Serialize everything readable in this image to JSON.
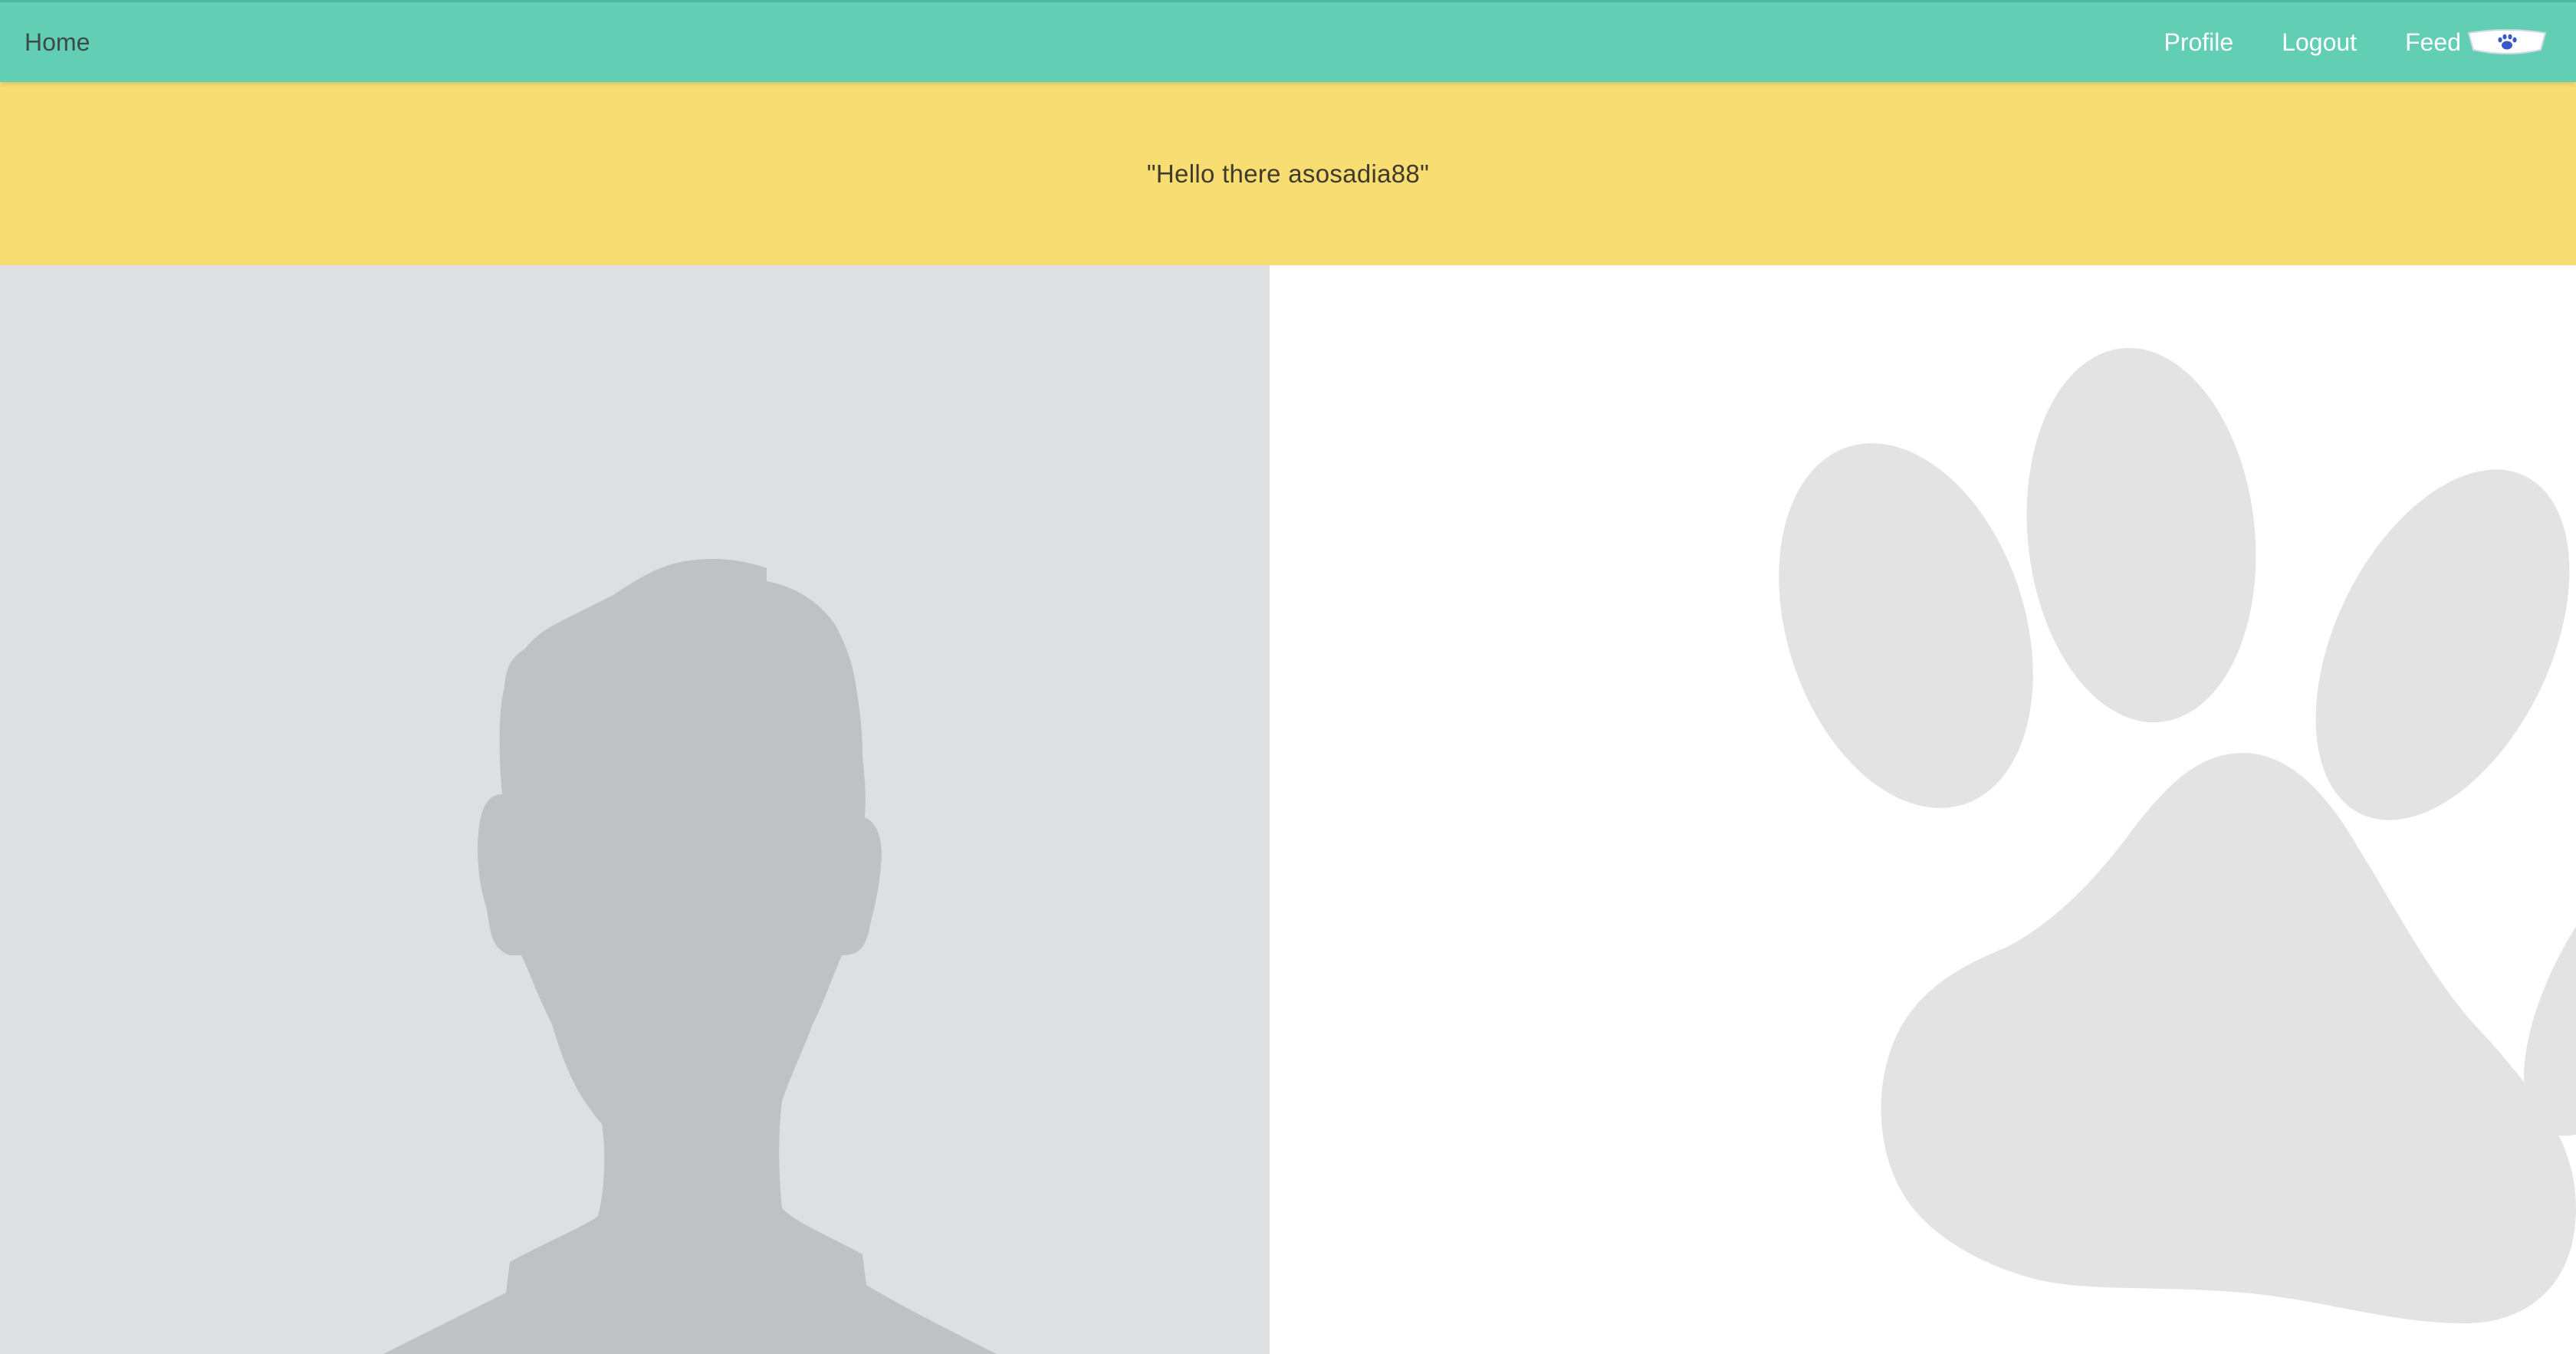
{
  "navbar": {
    "home_label": "Home",
    "profile_label": "Profile",
    "logout_label": "Logout",
    "feed_label": "Feed",
    "feed_icon": "pet-bowl-icon",
    "background_color": "#62cfb5"
  },
  "banner": {
    "greeting": "\"Hello there asosadia88\"",
    "background_color": "#f8de72"
  },
  "avatar": {
    "icon": "person-silhouette-icon",
    "background_color": "#dedfe1"
  },
  "pet_image": {
    "icon": "paw-print-icon"
  }
}
